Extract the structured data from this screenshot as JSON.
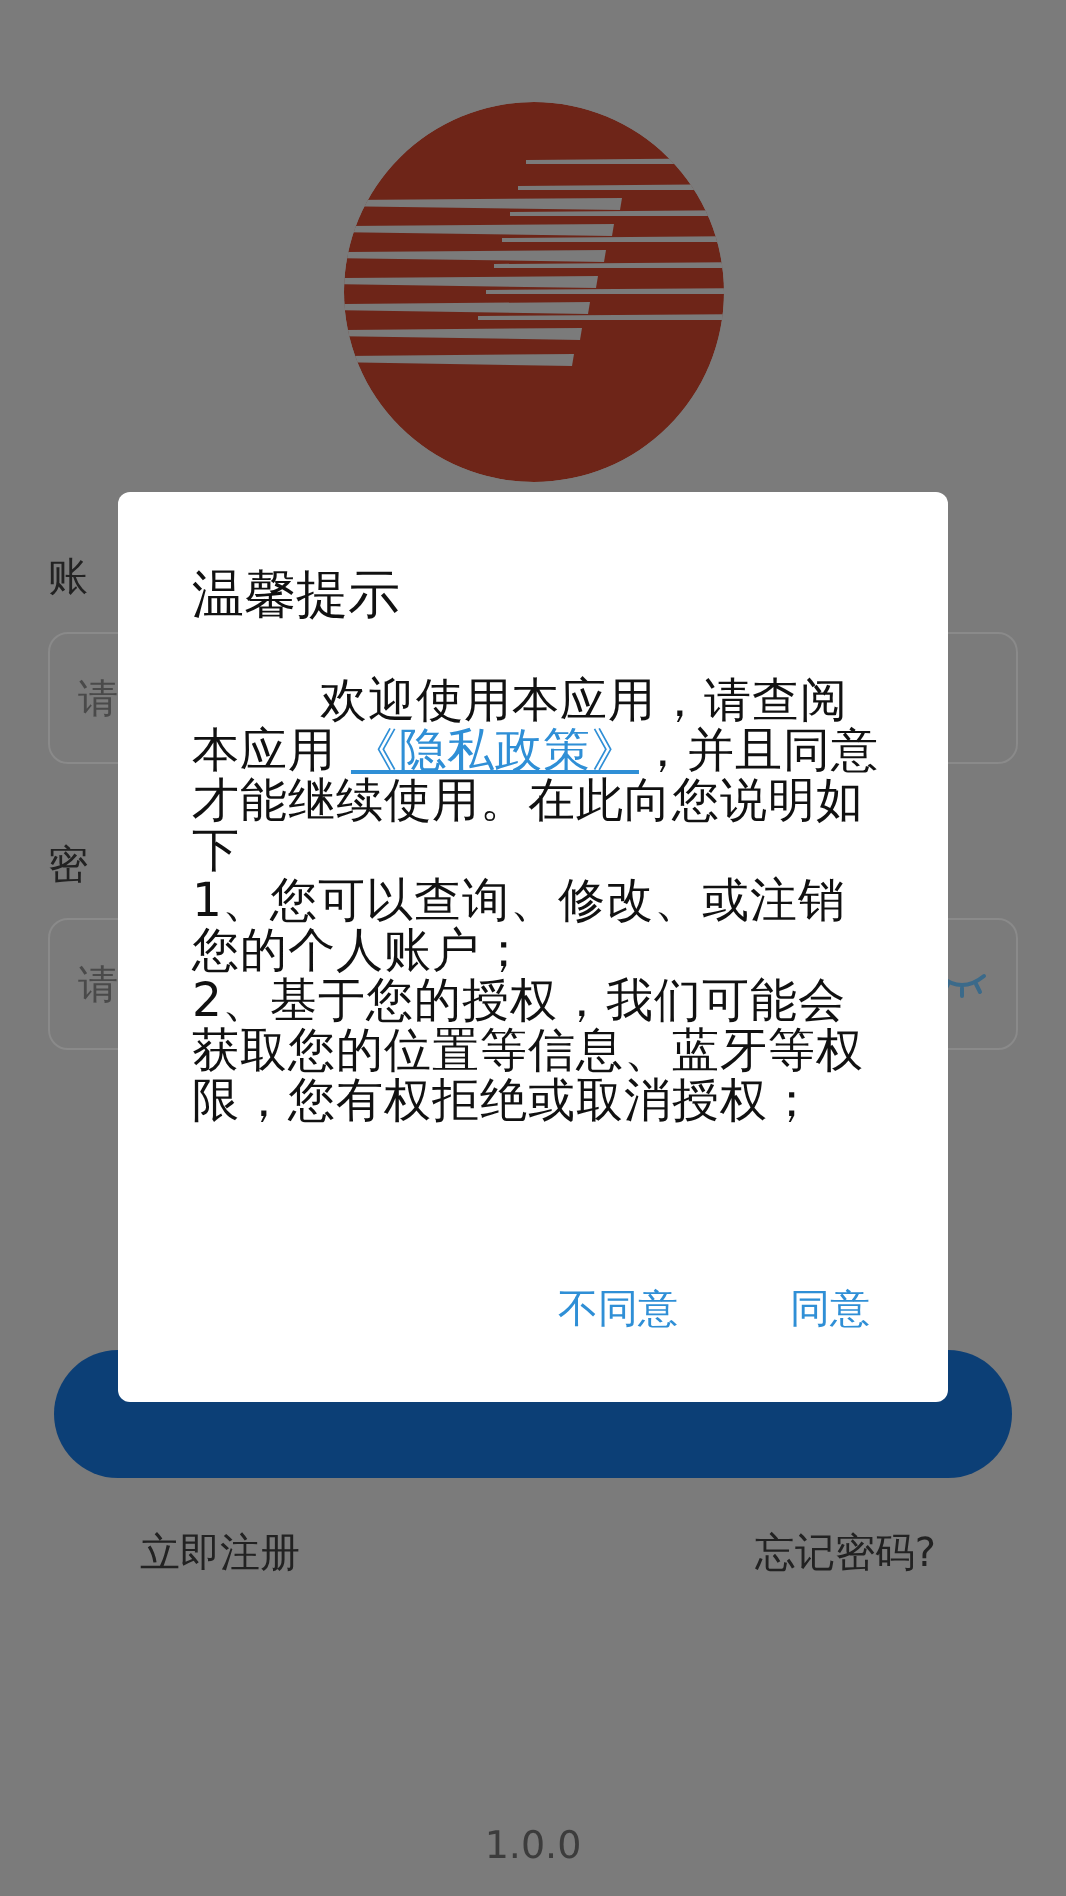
{
  "login_form": {
    "account_label": "账",
    "account_placeholder": "请",
    "password_label": "密",
    "password_placeholder": "请",
    "password_visible": false,
    "register_link": "立即注册",
    "forgot_link": "忘记密码?",
    "version": "1.0.0"
  },
  "dialog": {
    "title": "温馨提示",
    "body_before": "欢迎使用本应用，请查阅本应用 ",
    "body_link": "《隐私政策》",
    "body_after": "，并且同意才能继续使用。在此向您说明如下",
    "items": [
      "1、您可以查询、修改、或注销您的个人账户；",
      "2、基于您的授权，我们可能会获取您的位置等信息、蓝牙等权限，您有权拒绝或取消授权；"
    ],
    "buttons": [
      "不同意",
      "同意"
    ]
  }
}
